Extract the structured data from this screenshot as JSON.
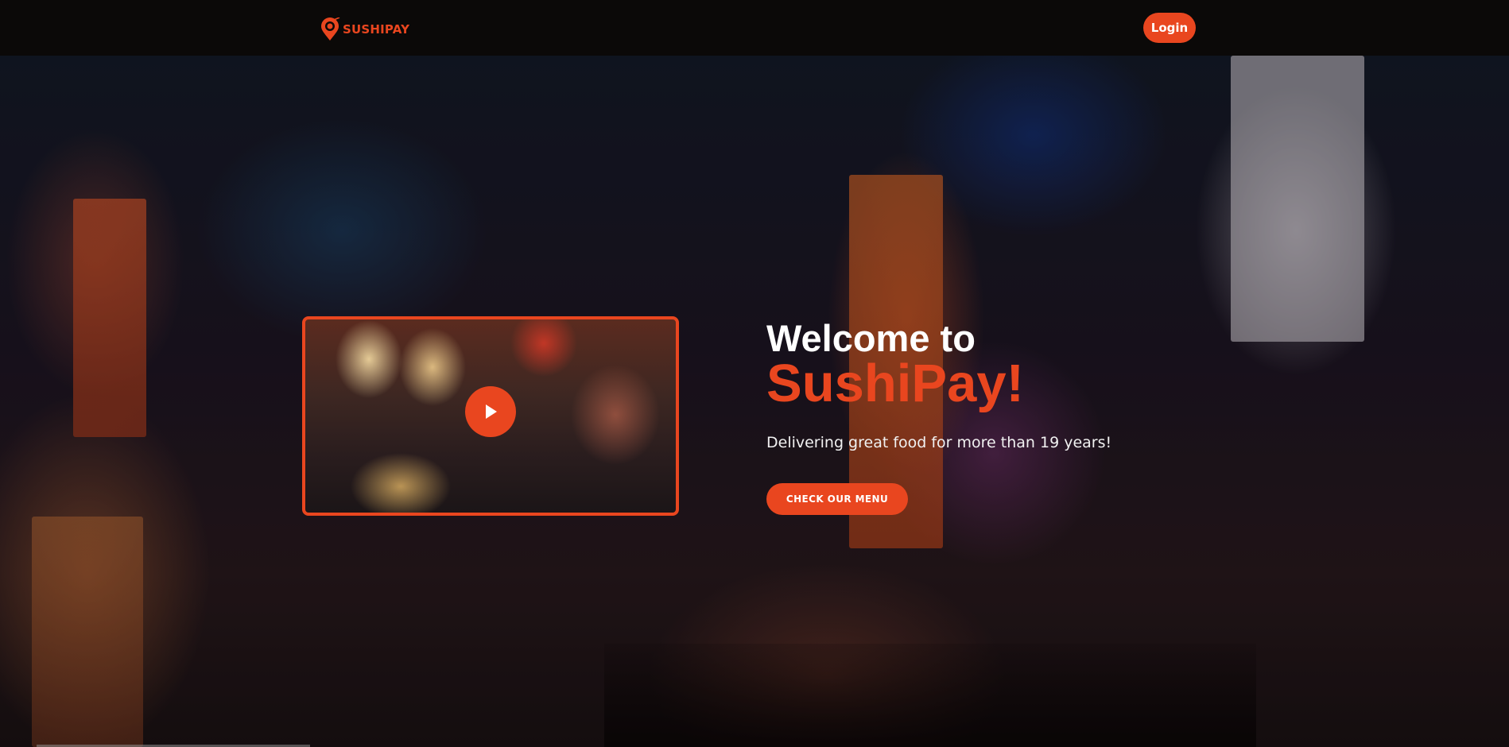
{
  "header": {
    "logo_text": "SUSHIPAY",
    "logo_icon": "sushi-pin-icon",
    "login_label": "Login"
  },
  "hero": {
    "title_line1": "Welcome to",
    "title_line2": "SushiPay!",
    "tagline": "Delivering great food for more than 19 years!",
    "cta_label": "CHECK OUR MENU",
    "play_icon": "play-icon"
  },
  "colors": {
    "accent": "#e9461f",
    "navbar": "#0b0908",
    "text": "#ffffff"
  }
}
